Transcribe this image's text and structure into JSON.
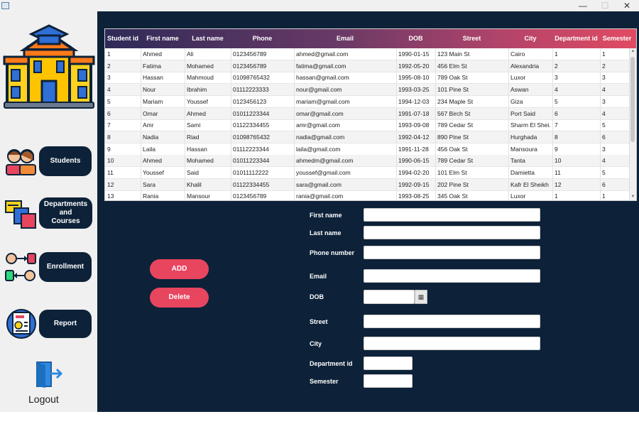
{
  "window": {
    "minimize": "—",
    "maximize": "☐",
    "close": "✕"
  },
  "sidebar": {
    "nav": [
      {
        "label": "Students"
      },
      {
        "label": "Departments\nand\nCourses"
      },
      {
        "label": "Enrollment"
      },
      {
        "label": "Report"
      }
    ],
    "logout": "Logout"
  },
  "table": {
    "columns": [
      "Student id",
      "First name",
      "Last name",
      "Phone",
      "Email",
      "DOB",
      "Street",
      "City",
      "Department id",
      "Semester"
    ],
    "rows": [
      [
        "1",
        "Ahmed",
        "Ali",
        "0123456789",
        "ahmed@gmail.com",
        "1990-01-15",
        "123 Main St",
        "Cairo",
        "1",
        "1"
      ],
      [
        "2",
        "Fatima",
        "Mohamed",
        "0123456789",
        "fatima@gmail.com",
        "1992-05-20",
        "456 Elm St",
        "Alexandria",
        "2",
        "2"
      ],
      [
        "3",
        "Hassan",
        "Mahmoud",
        "01098765432",
        "hassan@gmail.com",
        "1995-08-10",
        "789 Oak St",
        "Luxor",
        "3",
        "3"
      ],
      [
        "4",
        "Nour",
        "Ibrahim",
        "01112223333",
        "nour@gmail.com",
        "1993-03-25",
        "101 Pine St",
        "Aswan",
        "4",
        "4"
      ],
      [
        "5",
        "Mariam",
        "Youssef",
        "0123456123",
        "mariam@gmail.com",
        "1994-12-03",
        "234 Maple St",
        "Giza",
        "5",
        "3"
      ],
      [
        "6",
        "Omar",
        "Ahmed",
        "01011223344",
        "omar@gmail.com",
        "1991-07-18",
        "567 Birch St",
        "Port Said",
        "6",
        "4"
      ],
      [
        "7",
        "Amr",
        "Sami",
        "01122334455",
        "amr@gmail.com",
        "1993-09-08",
        "789 Cedar St",
        "Sharm El Shei...",
        "7",
        "5"
      ],
      [
        "8",
        "Nadia",
        "Riad",
        "01098765432",
        "nadia@gmail.com",
        "1992-04-12",
        "890 Pine St",
        "Hurghada",
        "8",
        "6"
      ],
      [
        "9",
        "Laila",
        "Hassan",
        "01112223344",
        "laila@gmail.com",
        "1991-11-28",
        "456 Oak St",
        "Mansoura",
        "9",
        "3"
      ],
      [
        "10",
        "Ahmed",
        "Mohamed",
        "01011223344",
        "ahmedm@gmail.com",
        "1990-06-15",
        "789 Cedar St",
        "Tanta",
        "10",
        "4"
      ],
      [
        "11",
        "Youssef",
        "Said",
        "01011112222",
        "youssef@gmail.com",
        "1994-02-20",
        "101 Elm St",
        "Damietta",
        "11",
        "5"
      ],
      [
        "12",
        "Sara",
        "Khalil",
        "01122334455",
        "sara@gmail.com",
        "1992-09-15",
        "202 Pine St",
        "Kafr El Sheikh",
        "12",
        "6"
      ],
      [
        "13",
        "Rania",
        "Mansour",
        "0123456789",
        "rania@gmail.com",
        "1993-08-25",
        "345 Oak St",
        "Luxor",
        "1",
        "1"
      ]
    ]
  },
  "form": {
    "fields": [
      {
        "label": "First name",
        "value": ""
      },
      {
        "label": "Last name",
        "value": ""
      },
      {
        "label": "Phone number",
        "value": ""
      },
      {
        "label": "Email",
        "value": ""
      },
      {
        "label": "DOB",
        "value": ""
      },
      {
        "label": "Street",
        "value": ""
      },
      {
        "label": "City",
        "value": ""
      },
      {
        "label": "Department id",
        "value": ""
      },
      {
        "label": "Semester",
        "value": ""
      }
    ],
    "add_label": "ADD",
    "delete_label": "Delete"
  }
}
